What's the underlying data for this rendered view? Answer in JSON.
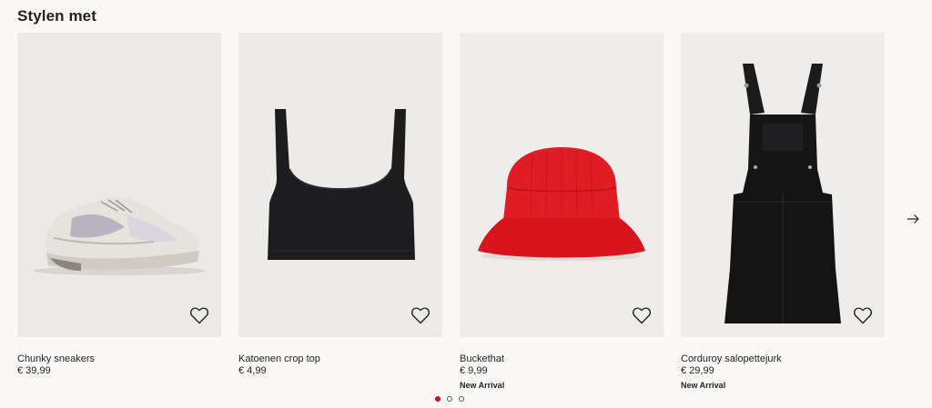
{
  "section": {
    "title": "Stylen met"
  },
  "products": [
    {
      "name": "Chunky sneakers",
      "price": "€ 39,99",
      "badge": "",
      "favorite_icon": "heart-icon",
      "image_bg": "#ebeae7"
    },
    {
      "name": "Katoenen crop top",
      "price": "€ 4,99",
      "badge": "",
      "favorite_icon": "heart-icon",
      "image_bg": "#ecebe9"
    },
    {
      "name": "Buckethat",
      "price": "€ 9,99",
      "badge": "New Arrival",
      "favorite_icon": "heart-icon",
      "image_bg": "#eeedeb"
    },
    {
      "name": "Corduroy salopettejurk",
      "price": "€ 29,99",
      "badge": "New Arrival",
      "favorite_icon": "heart-icon",
      "image_bg": "#eeedeb"
    }
  ],
  "navigation": {
    "next_icon": "arrow-right-icon"
  },
  "pagination": {
    "pages": 3,
    "active_page": 1,
    "active_color": "#e50010"
  }
}
